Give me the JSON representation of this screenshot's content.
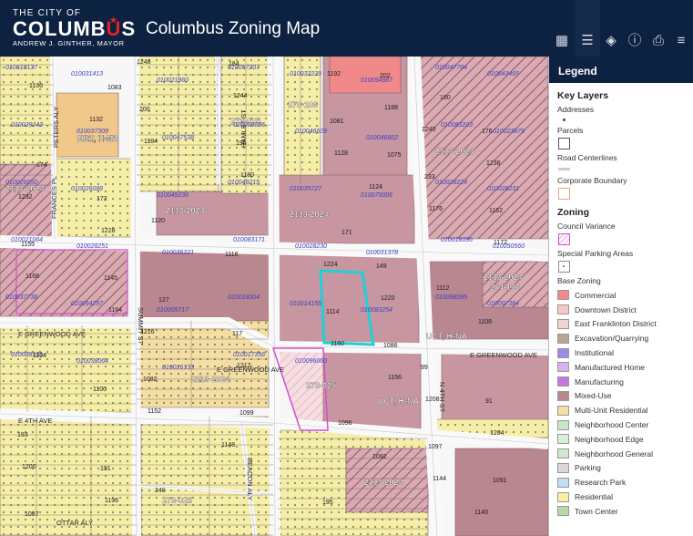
{
  "header": {
    "logo_top": "THE CITY OF",
    "logo_main_a": "COLUMB",
    "logo_main_b": "U",
    "logo_main_c": "S",
    "logo_mayor": "ANDREW J. GINTHER, MAYOR",
    "title": "Columbus Zoning Map",
    "tools": [
      {
        "name": "basemap-gallery-icon",
        "glyph": "▦"
      },
      {
        "name": "legend-list-icon",
        "glyph": "☰"
      },
      {
        "name": "layers-icon",
        "glyph": "◈"
      },
      {
        "name": "info-icon",
        "glyph": "ⓘ"
      },
      {
        "name": "print-icon",
        "glyph": "⎙"
      },
      {
        "name": "menu-icon",
        "glyph": "≡"
      }
    ]
  },
  "legend": {
    "title": "Legend",
    "key_layers_title": "Key Layers",
    "key_layers": [
      {
        "label": "Addresses",
        "symbol": "addr"
      },
      {
        "label": "Parcels",
        "symbol": "parcel"
      },
      {
        "label": "Road Centerlines",
        "symbol": "road"
      },
      {
        "label": "Corporate Boundary",
        "symbol": "corp"
      }
    ],
    "zoning_title": "Zoning",
    "zoning_layers": [
      {
        "label": "Council Variance",
        "symbol": "council"
      },
      {
        "label": "Special Parking Areas",
        "symbol": "parking"
      }
    ],
    "base_zoning_label": "Base Zoning",
    "base_zoning": [
      {
        "label": "Commercial",
        "color": "#f08a8a"
      },
      {
        "label": "Downtown District",
        "color": "#f6c7c7"
      },
      {
        "label": "East Franklinton District",
        "color": "#f3d2d2"
      },
      {
        "label": "Excavation/Quarrying",
        "color": "#b8a594"
      },
      {
        "label": "Institutional",
        "color": "#9b8ae8"
      },
      {
        "label": "Manufactured Home",
        "color": "#d8b2ec"
      },
      {
        "label": "Manufacturing",
        "color": "#c178e0"
      },
      {
        "label": "Mixed-Use",
        "color": "#b9878f"
      },
      {
        "label": "Multi-Unit Residential",
        "color": "#f3dfa3"
      },
      {
        "label": "Neighborhood Center",
        "color": "#c9e6c7"
      },
      {
        "label": "Neighborhood Edge",
        "color": "#d9eed7"
      },
      {
        "label": "Neighborhood General",
        "color": "#cfe8cd"
      },
      {
        "label": "Parking",
        "color": "#d8d8d8"
      },
      {
        "label": "Research Park",
        "color": "#bfe0f0"
      },
      {
        "label": "Residential",
        "color": "#f7f0a0"
      },
      {
        "label": "Town Center",
        "color": "#b6d9a9"
      }
    ]
  },
  "map": {
    "colors": {
      "road": "#f7f7f7",
      "mixed_use": "#b9878f",
      "mixed_use_light": "#d9aab2",
      "residential": "#f5eea6",
      "multi_unit": "#f3dfa3",
      "parcel_line": "#7a5d63",
      "label": "#3c3fc4",
      "council": "#d04fd0",
      "selection": "#21d0d6"
    },
    "streets": [
      "PETERS ALY",
      "FRANCES PL",
      "HAMLET ST",
      "SUMMIT ST",
      "E GREENWOOD AVE",
      "E GREENWOOD AVE",
      "E GREENWOOD AVE",
      "E 4TH AVE",
      "N 4TH ST",
      "BEACON ALY",
      "OTTAR ALY"
    ],
    "zones": [
      "AR1, H-35",
      "2113-2024",
      "2113-2024",
      "2113-2024",
      "2113-2024",
      "2113-2024",
      "2113-2024",
      "2113-2024",
      "273-025",
      "273-025",
      "273-025",
      "278-106",
      "274-106",
      "UCT, H-NA",
      "UCT, H-NA",
      "UCT, H-NA"
    ],
    "parcels": [
      "010018137",
      "010031413",
      "010021960",
      "010057207",
      "010032229",
      "010094987",
      "010047764",
      "010043465",
      "010029243",
      "010037309",
      "010047538",
      "010009236",
      "010046629",
      "010046802",
      "010083203",
      "010023879",
      "010026050",
      "010026088",
      "010049236",
      "010049215",
      "010035727",
      "010070006",
      "010028224",
      "010028231",
      "010021064",
      "010028251",
      "010036221",
      "010083171",
      "010028230",
      "010031378",
      "010018096",
      "010050560",
      "010037738",
      "010054297",
      "010005717",
      "010018004",
      "010014155",
      "010083254",
      "010098095",
      "010007384",
      "010028131",
      "010038064",
      "010026133",
      "010017356",
      "010096060"
    ],
    "numbers": [
      "1248",
      "1244",
      "1240",
      "1236",
      "1232",
      "1228",
      "1224",
      "1220",
      "1216",
      "1212",
      "1208",
      "1204",
      "1200",
      "1196",
      "1192",
      "1188",
      "1184",
      "1180",
      "1176",
      "1172",
      "1168",
      "1164",
      "1160",
      "1156",
      "1152",
      "1148",
      "1144",
      "1140",
      "1136",
      "1132",
      "1128",
      "1124",
      "1120",
      "1116",
      "1112",
      "1108",
      "1104",
      "1100",
      "1096",
      "1092",
      "240",
      "184",
      "180",
      "176",
      "174",
      "172",
      "171",
      "149",
      "127",
      "117",
      "99",
      "91",
      "193",
      "191",
      "195",
      "202",
      "200",
      "196",
      "233",
      "1162",
      "1155",
      "1145",
      "1114",
      "1086",
      "1082",
      "1099",
      "1097",
      "1091",
      "1087",
      "1083",
      "1081",
      "1075"
    ]
  }
}
